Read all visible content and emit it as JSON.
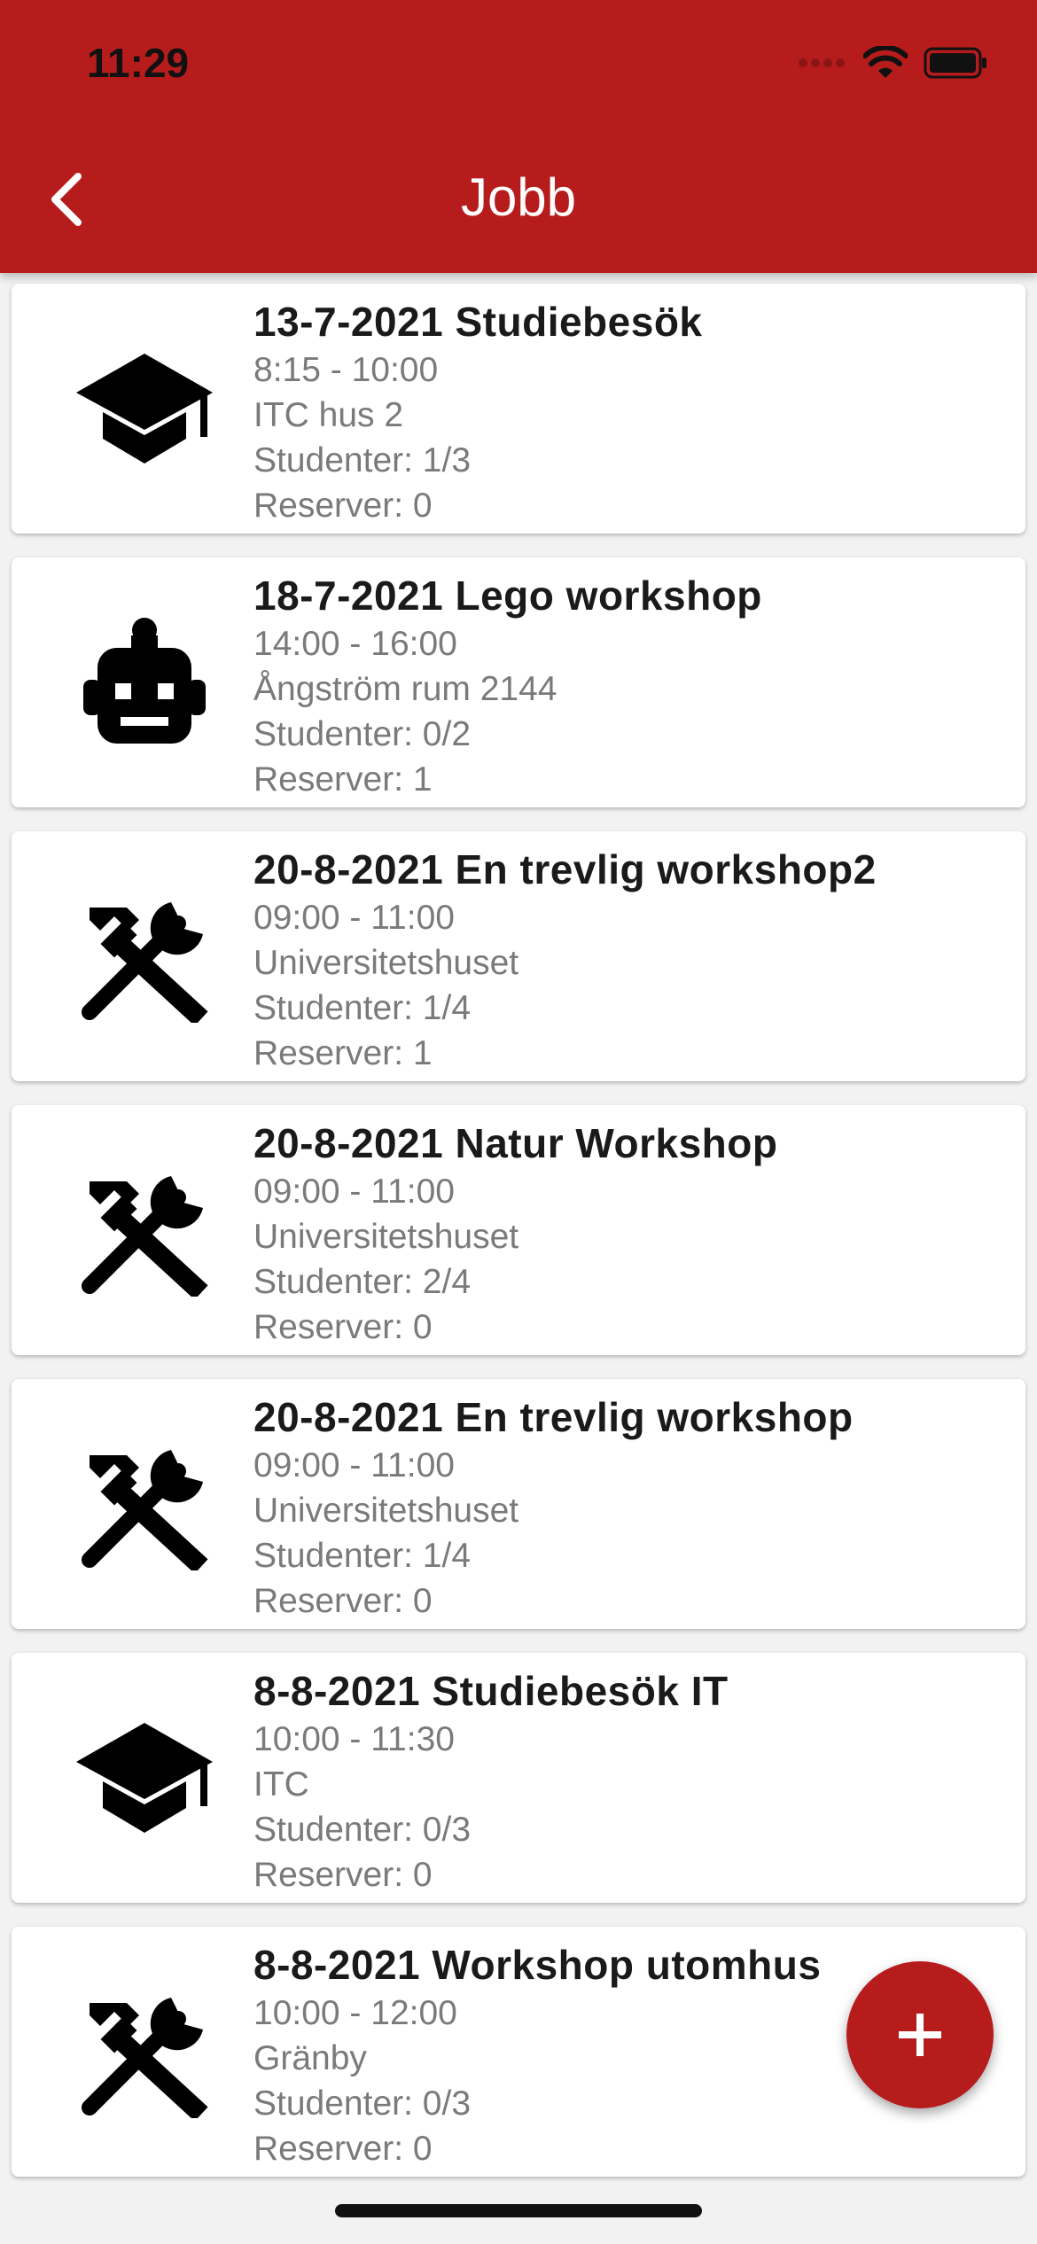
{
  "status_bar": {
    "time": "11:29"
  },
  "header": {
    "title": "Jobb",
    "back_icon": "chevron-left-icon"
  },
  "colors": {
    "primary": "#b71c1c",
    "card_bg": "#ffffff",
    "page_bg": "#f2f2f2",
    "secondary_text": "#7a7a7a"
  },
  "jobs": [
    {
      "icon": "graduation-cap-icon",
      "title": "13-7-2021 Studiebesök",
      "time": "8:15 - 10:00",
      "location": "ITC hus 2",
      "students": "Studenter: 1/3",
      "reserves": "Reserver: 0"
    },
    {
      "icon": "robot-icon",
      "title": "18-7-2021 Lego workshop",
      "time": "14:00 - 16:00",
      "location": "Ångström rum 2144",
      "students": "Studenter: 0/2",
      "reserves": "Reserver: 1"
    },
    {
      "icon": "tools-icon",
      "title": "20-8-2021 En trevlig workshop2",
      "time": "09:00 - 11:00",
      "location": "Universitetshuset",
      "students": "Studenter: 1/4",
      "reserves": "Reserver: 1"
    },
    {
      "icon": "tools-icon",
      "title": "20-8-2021 Natur Workshop",
      "time": "09:00 - 11:00",
      "location": "Universitetshuset",
      "students": "Studenter: 2/4",
      "reserves": "Reserver: 0"
    },
    {
      "icon": "tools-icon",
      "title": "20-8-2021 En trevlig workshop",
      "time": "09:00 - 11:00",
      "location": "Universitetshuset",
      "students": "Studenter: 1/4",
      "reserves": "Reserver: 0"
    },
    {
      "icon": "graduation-cap-icon",
      "title": "8-8-2021 Studiebesök IT",
      "time": "10:00 - 11:30",
      "location": "ITC",
      "students": "Studenter: 0/3",
      "reserves": "Reserver: 0"
    },
    {
      "icon": "tools-icon",
      "title": "8-8-2021 Workshop utomhus",
      "time": "10:00 - 12:00",
      "location": "Gränby",
      "students": "Studenter: 0/3",
      "reserves": "Reserver: 0"
    }
  ],
  "fab": {
    "icon": "plus-icon"
  }
}
